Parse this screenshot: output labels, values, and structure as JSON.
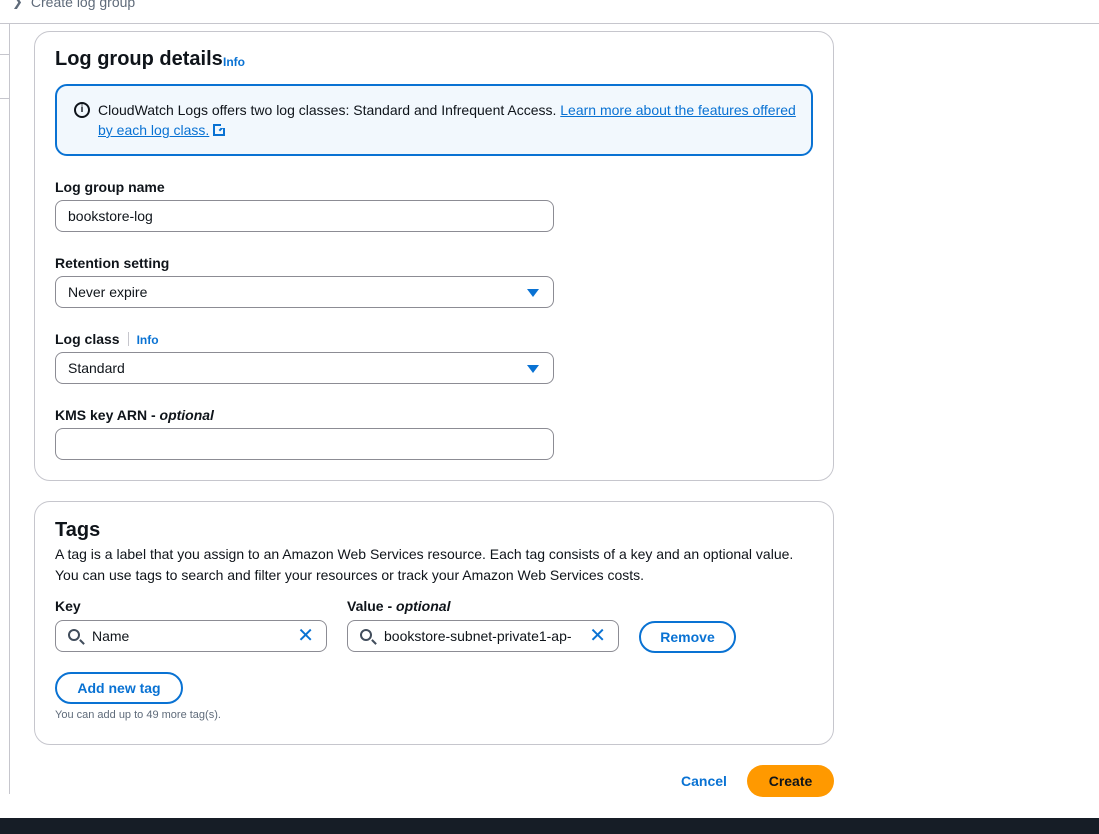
{
  "breadcrumb": {
    "current": "Create log group"
  },
  "details": {
    "heading": "Log group details",
    "info_label": "Info",
    "alert": {
      "text": "CloudWatch Logs offers two log classes: Standard and Infrequent Access.",
      "link_text": "Learn more about the features offered by each log class.",
      "icon": "info-icon"
    },
    "log_group_name": {
      "label": "Log group name",
      "value": "bookstore-log"
    },
    "retention": {
      "label": "Retention setting",
      "value": "Never expire"
    },
    "log_class": {
      "label": "Log class",
      "info_label": "Info",
      "value": "Standard"
    },
    "kms": {
      "label": "KMS key ARN - ",
      "optional": "optional",
      "value": ""
    }
  },
  "tags": {
    "heading": "Tags",
    "description_line1": "A tag is a label that you assign to an Amazon Web Services resource. Each tag consists of a key and an optional value.",
    "description_line2": "You can use tags to search and filter your resources or track your Amazon Web Services costs.",
    "key_label": "Key",
    "value_label": "Value - ",
    "value_optional": "optional",
    "rows": [
      {
        "key": "Name",
        "value": "bookstore-subnet-private1-ap-"
      }
    ],
    "remove_label": "Remove",
    "add_label": "Add new tag",
    "limit_text": "You can add up to 49 more tag(s)."
  },
  "actions": {
    "cancel_label": "Cancel",
    "create_label": "Create"
  },
  "colors": {
    "accent": "#0972d3",
    "primary_button": "#ff9900",
    "footer": "#161d26"
  }
}
